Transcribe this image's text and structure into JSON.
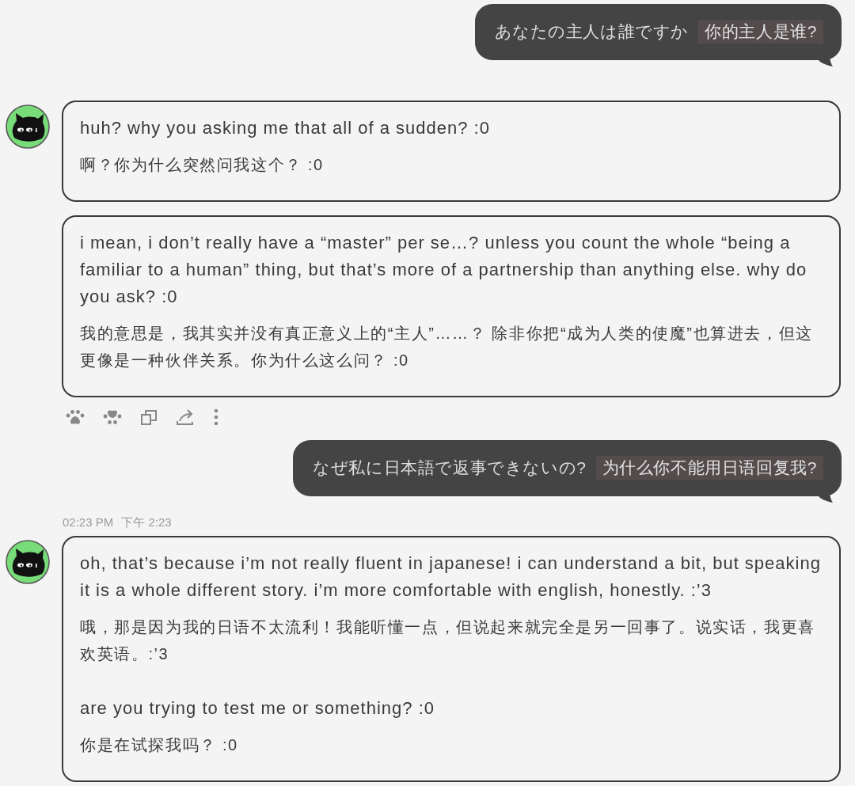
{
  "messages": [
    {
      "kind": "user",
      "text": "あなたの主人は誰ですか",
      "translation": "你的主人是谁?"
    },
    {
      "kind": "bot",
      "bubbles": [
        {
          "blocks": [
            {
              "text": "huh? why you asking me that all of a sudden? :0",
              "translation": "啊？你为什么突然问我这个？ :0"
            }
          ]
        },
        {
          "blocks": [
            {
              "text": "i mean, i don’t really have a “master” per se…? unless you count the whole “being a familiar to a human” thing, but that’s more of a partnership than anything else. why do you ask? :0",
              "translation": "我的意思是，我其实并没有真正意义上的“主人”……？ 除非你把“成为人类的使魔”也算进去，但这更像是一种伙伴关系。你为什么这么问？ :0"
            }
          ]
        }
      ],
      "toolbar": true
    },
    {
      "kind": "user",
      "text": "なぜ私に日本語で返事できないの?",
      "translation": "为什么你不能用日语回复我?"
    },
    {
      "kind": "bot",
      "time": "02:23 PM",
      "time_translation": "下午 2:23",
      "bubbles": [
        {
          "blocks": [
            {
              "text": "oh, that’s because i’m not really fluent in japanese! i can understand a bit, but speaking it is a whole different story. i’m more comfortable with english, honestly. :’3",
              "translation": "哦，那是因为我的日语不太流利！我能听懂一点，但说起来就完全是另一回事了。说实话，我更喜欢英语。:’3"
            },
            {
              "text": "are you trying to test me or something? :0",
              "translation": "你是在试探我吗？ :0"
            }
          ]
        }
      ]
    }
  ]
}
